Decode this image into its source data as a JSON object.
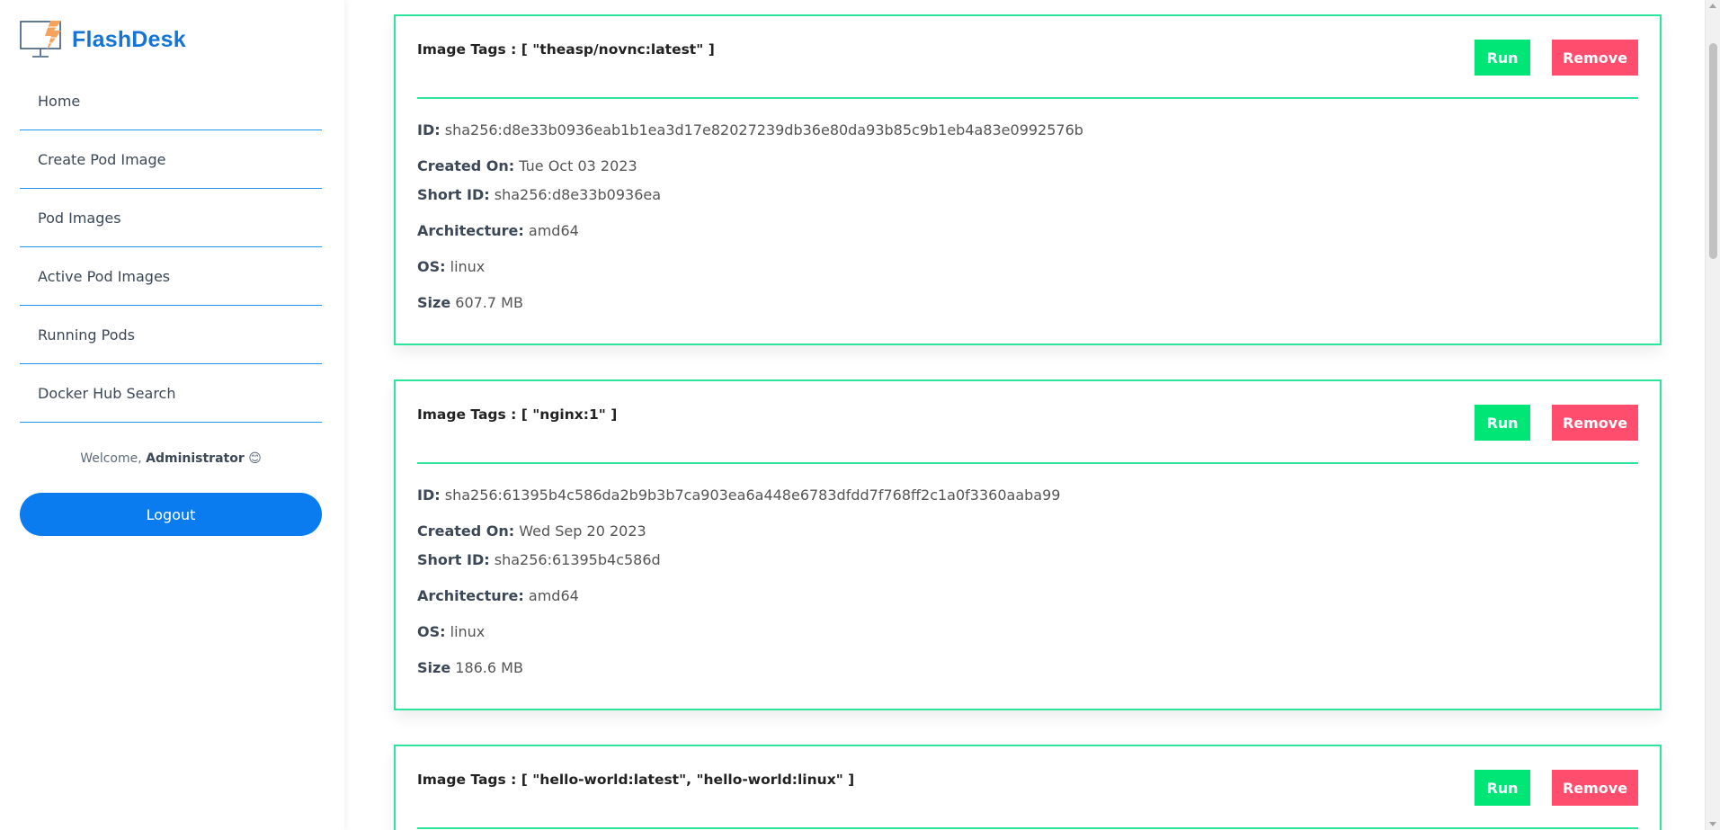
{
  "brand": {
    "name": "FlashDesk",
    "logo_icon": "desktop-lightning-icon"
  },
  "sidebar": {
    "items": [
      {
        "label": "Home"
      },
      {
        "label": "Create Pod Image"
      },
      {
        "label": "Pod Images"
      },
      {
        "label": "Active Pod Images"
      },
      {
        "label": "Running Pods"
      },
      {
        "label": "Docker Hub Search"
      }
    ],
    "welcome_prefix": "Welcome,",
    "welcome_user": "Administrator",
    "welcome_emoji": "😊",
    "logout_label": "Logout"
  },
  "labels": {
    "id": "ID:",
    "created": "Created On:",
    "short_id": "Short ID:",
    "arch": "Architecture:",
    "os": "OS:",
    "size": "Size",
    "run": "Run",
    "remove": "Remove"
  },
  "images": [
    {
      "tags_title": "Image Tags : [ \"theasp/novnc:latest\" ]",
      "id": "sha256:d8e33b0936eab1b1ea3d17e82027239db36e80da93b85c9b1eb4a83e0992576b",
      "created": "Tue Oct 03 2023",
      "short_id": "sha256:d8e33b0936ea",
      "arch": "amd64",
      "os": "linux",
      "size": "607.7 MB"
    },
    {
      "tags_title": "Image Tags : [ \"nginx:1\" ]",
      "id": "sha256:61395b4c586da2b9b3b7ca903ea6a448e6783dfdd7f768ff2c1a0f3360aaba99",
      "created": "Wed Sep 20 2023",
      "short_id": "sha256:61395b4c586d",
      "arch": "amd64",
      "os": "linux",
      "size": "186.6 MB"
    },
    {
      "tags_title": "Image Tags : [ \"hello-world:latest\", \"hello-world:linux\" ]"
    }
  ],
  "colors": {
    "accent": "#2ee59d",
    "run": "#00e676",
    "remove": "#ff4d6d",
    "brand": "#1574d4",
    "logout": "#0a7cf0"
  }
}
